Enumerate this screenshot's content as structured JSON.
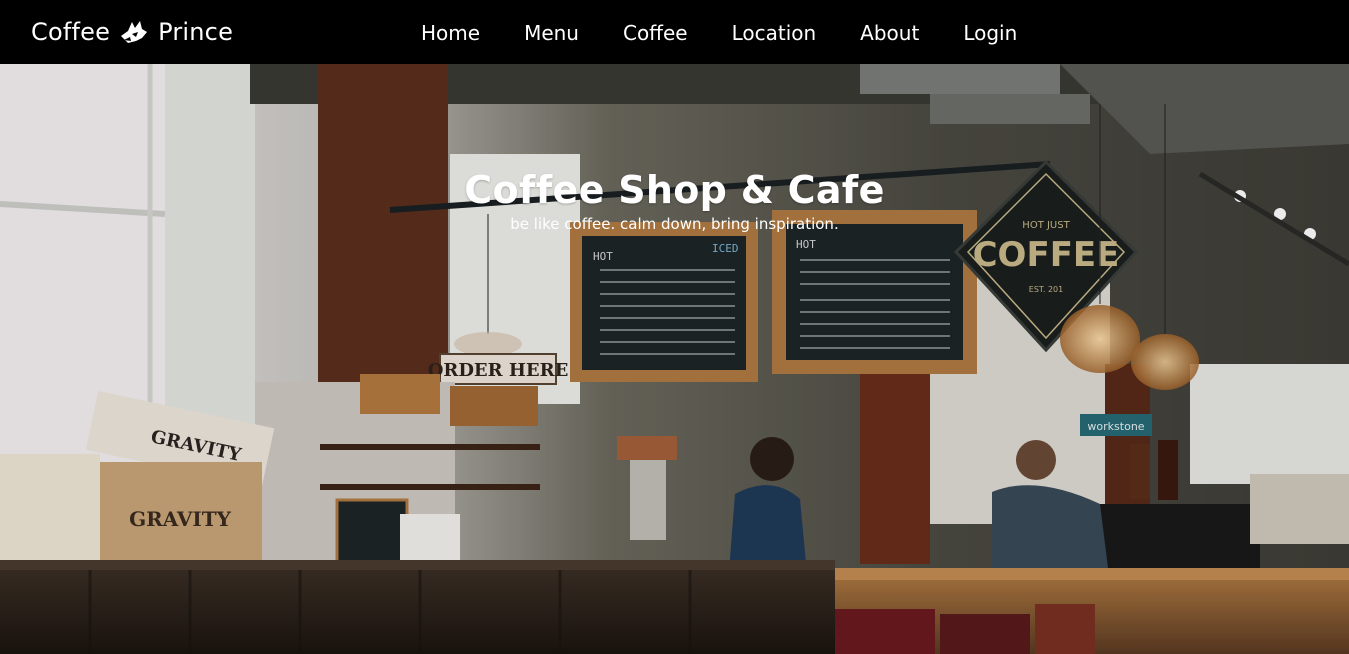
{
  "brand": {
    "name_left": "Coffee",
    "name_right": "Prince",
    "logo_icon": "fox-logo-icon"
  },
  "nav": {
    "items": [
      {
        "label": "Home"
      },
      {
        "label": "Menu"
      },
      {
        "label": "Coffee"
      },
      {
        "label": "Location"
      },
      {
        "label": "About"
      },
      {
        "label": "Login"
      }
    ]
  },
  "hero": {
    "title": "Coffee Shop & Cafe",
    "subtitle": "be like coffee. calm down, bring inspiration."
  },
  "scene_text": {
    "crate_top": "GRAVITY",
    "crate_front": "GRAVITY",
    "order_sign": "ORDER HERE",
    "diamond_top": "HOT JUST",
    "diamond_main": "COFFEE",
    "diamond_bottom": "EST. 201",
    "board_left_hot": "HOT",
    "board_left_iced": "ICED",
    "board_right_hot": "HOT",
    "wall_sign": "workstone"
  },
  "colors": {
    "navbar": "#000000",
    "text": "#ffffff",
    "wood": "#b07a42",
    "chalkboard": "#1d2528"
  }
}
